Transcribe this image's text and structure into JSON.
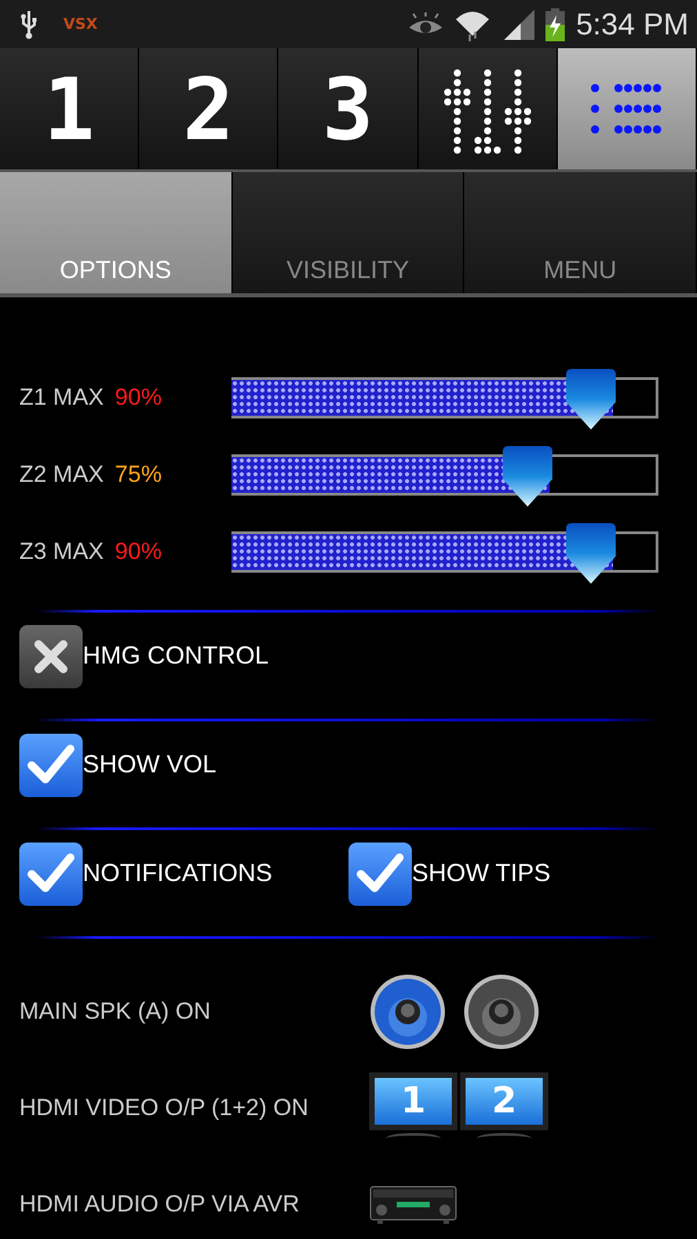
{
  "status_bar": {
    "app_badge": "VSX",
    "time": "5:34 PM"
  },
  "top_tabs": [
    {
      "kind": "digit",
      "label": "1",
      "selected": false
    },
    {
      "kind": "digit",
      "label": "2",
      "selected": false
    },
    {
      "kind": "digit",
      "label": "3",
      "selected": false
    },
    {
      "kind": "mixer",
      "selected": false
    },
    {
      "kind": "list",
      "selected": true
    }
  ],
  "sub_tabs": [
    {
      "label": "OPTIONS",
      "selected": true
    },
    {
      "label": "VISIBILITY",
      "selected": false
    },
    {
      "label": "MENU",
      "selected": false
    }
  ],
  "sliders": [
    {
      "label": "Z1 MAX",
      "value": "90%",
      "color": "#ff1a1a",
      "level": 0.9
    },
    {
      "label": "Z2 MAX",
      "value": "75%",
      "color": "#ffa41c",
      "level": 0.75
    },
    {
      "label": "Z3 MAX",
      "value": "90%",
      "color": "#ff1a1a",
      "level": 0.9
    }
  ],
  "checkbox_rows": [
    [
      {
        "label": "HMG CONTROL",
        "checked": false
      }
    ],
    [
      {
        "label": "SHOW VOL",
        "checked": true
      }
    ],
    [
      {
        "label": "NOTIFICATIONS",
        "checked": true
      },
      {
        "label": "SHOW TIPS",
        "checked": true
      }
    ]
  ],
  "outputs": [
    {
      "label": "MAIN SPK (A) ON",
      "kind": "speakers",
      "items": [
        {
          "on": true
        },
        {
          "on": false
        }
      ]
    },
    {
      "label": "HDMI VIDEO O/P (1+2) ON",
      "kind": "monitors",
      "items": [
        {
          "label": "1"
        },
        {
          "label": "2"
        }
      ]
    },
    {
      "label": "HDMI AUDIO O/P VIA AVR",
      "kind": "receiver"
    }
  ]
}
